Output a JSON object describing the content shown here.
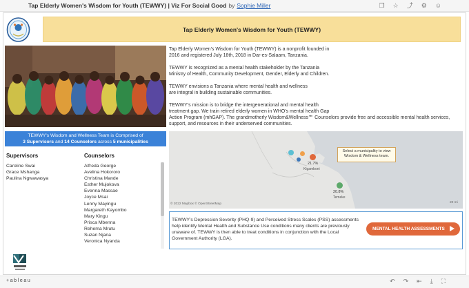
{
  "titlebar": {
    "title": "Tap Elderly Women's Wisdom for Youth (TEWWY) | Viz For Social Good",
    "by": "by",
    "author": "Sophie Miller",
    "icons": [
      "copy-icon",
      "star-icon",
      "share-icon",
      "settings-icon",
      "profile-icon"
    ]
  },
  "banner": {
    "title": "Tap Elderly Women's Wisdom for Youth (TEWWY)"
  },
  "about": {
    "p1_line1": "Tap Elderly Women's Wisdom for Youth (TEWWY) is a nonprofit founded in",
    "p1_line2": "2016 and registered July 18th, 2018 in Dar-es-Salaam, Tanzania.",
    "p2_line1": "TEWWY is recognized as a mental health stakeholder by the Tanzania",
    "p2_line2": "Ministry of Health, Community Development, Gender, Elderly and Children.",
    "p3_line1": "TEWWY envisions a Tanzania where mental health and wellness",
    "p3_line2": "are integral in building sustainable communities.",
    "p4_line1": "TEWWY's mission is to bridge the intergenerational and mental health",
    "p4_line2": "treatment gap. We train retired elderly women in WHO's mental health Gap",
    "p4_line3": "Action Program (mhGAP). The grandmotherly Wisdom&Wellness℠ Counselors provide free and accessible mental health services,",
    "p4_line4": "support, and resources in their underserved communities."
  },
  "team": {
    "line1": "TEWWY's Wisdom and Wellness Team is Comprised of",
    "count_sup": "3 Supervisors",
    "and": " and ",
    "count_couns": "14 Counselors",
    "across": " across ",
    "count_muni": "5 municipalities"
  },
  "supervisors": {
    "heading": "Supervisors",
    "names": [
      "Caroline Swai",
      "Grace Mshanga",
      "Paulina Ngwawasya"
    ]
  },
  "counselors": {
    "heading": "Counselors",
    "names": [
      "Alfreda George",
      "Avelina Hokororo",
      "Christina Mande",
      "Esther Mujokova",
      "Evenna Massae",
      "Joyce Msai",
      "Lenny Mayingu",
      "Margareth Kayombo",
      "Mary Kingu",
      "Prisca Mbenna",
      "Rehema Mrutu",
      "Suzan Njana",
      "Veronica Nyanda"
    ]
  },
  "map": {
    "callout": "Select a municipality to view Wisdom & Wellness team.",
    "label_kigamboni": "Kigamboni",
    "label_temeke": "Temeke",
    "pct_kigamboni": "21.7%",
    "pct_temeke": "20.8%",
    "copyright": "© 2022 Mapbox  © OpenStreetMap",
    "scale": "20 mi",
    "colors": {
      "teal": "#5bbfd3",
      "orange": "#f0a04b",
      "blue": "#3f78b9",
      "red": "#e0683b",
      "green": "#5da96a"
    }
  },
  "phq": {
    "line1": "TEWWY's Depression Severity (PHQ-9) and Perceived Stress Scales (PSS) assessments",
    "line2": "help identify Mental Health and Substance Use conditions many clients are previously",
    "line3": "unaware of. TEWWY is then able to treat conditions in conjunction with the Local",
    "line4": "Government Authority (LGA).",
    "button": "MENTAL HEALTH ASSESSMENTS"
  },
  "footer": {
    "brand": "+ableau"
  }
}
